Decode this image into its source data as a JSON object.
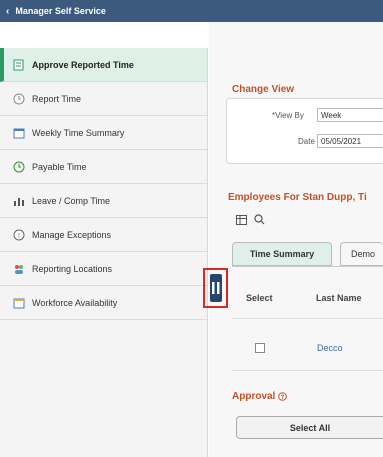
{
  "header": {
    "back_label": "Manager Self Service"
  },
  "sidebar": {
    "items": [
      {
        "label": "Approve Reported Time",
        "icon": "timesheet-icon",
        "active": true
      },
      {
        "label": "Report Time",
        "icon": "clock-icon"
      },
      {
        "label": "Weekly Time Summary",
        "icon": "calendar-icon"
      },
      {
        "label": "Payable Time",
        "icon": "dollar-clock-icon"
      },
      {
        "label": "Leave / Comp Time",
        "icon": "chart-icon"
      },
      {
        "label": "Manage Exceptions",
        "icon": "exception-icon"
      },
      {
        "label": "Reporting Locations",
        "icon": "people-icon"
      },
      {
        "label": "Workforce Availability",
        "icon": "calendar-people-icon"
      }
    ]
  },
  "change_view": {
    "title": "Change View",
    "view_by_label": "*View By",
    "view_by_value": "Week",
    "date_label": "Date",
    "date_value": "05/05/2021"
  },
  "employees": {
    "title": "Employees For Stan Dupp, Ti",
    "tabs": [
      "Time Summary",
      "Demo"
    ],
    "columns": [
      "Select",
      "Last Name"
    ],
    "rows": [
      {
        "last_name": "Decco"
      }
    ]
  },
  "approval": {
    "title": "Approval",
    "select_all_label": "Select All"
  },
  "colors": {
    "topbar": "#3c5a7e",
    "accent_orange": "#c0522a",
    "active_green": "#dff0e8",
    "highlight_red": "#d92828"
  }
}
